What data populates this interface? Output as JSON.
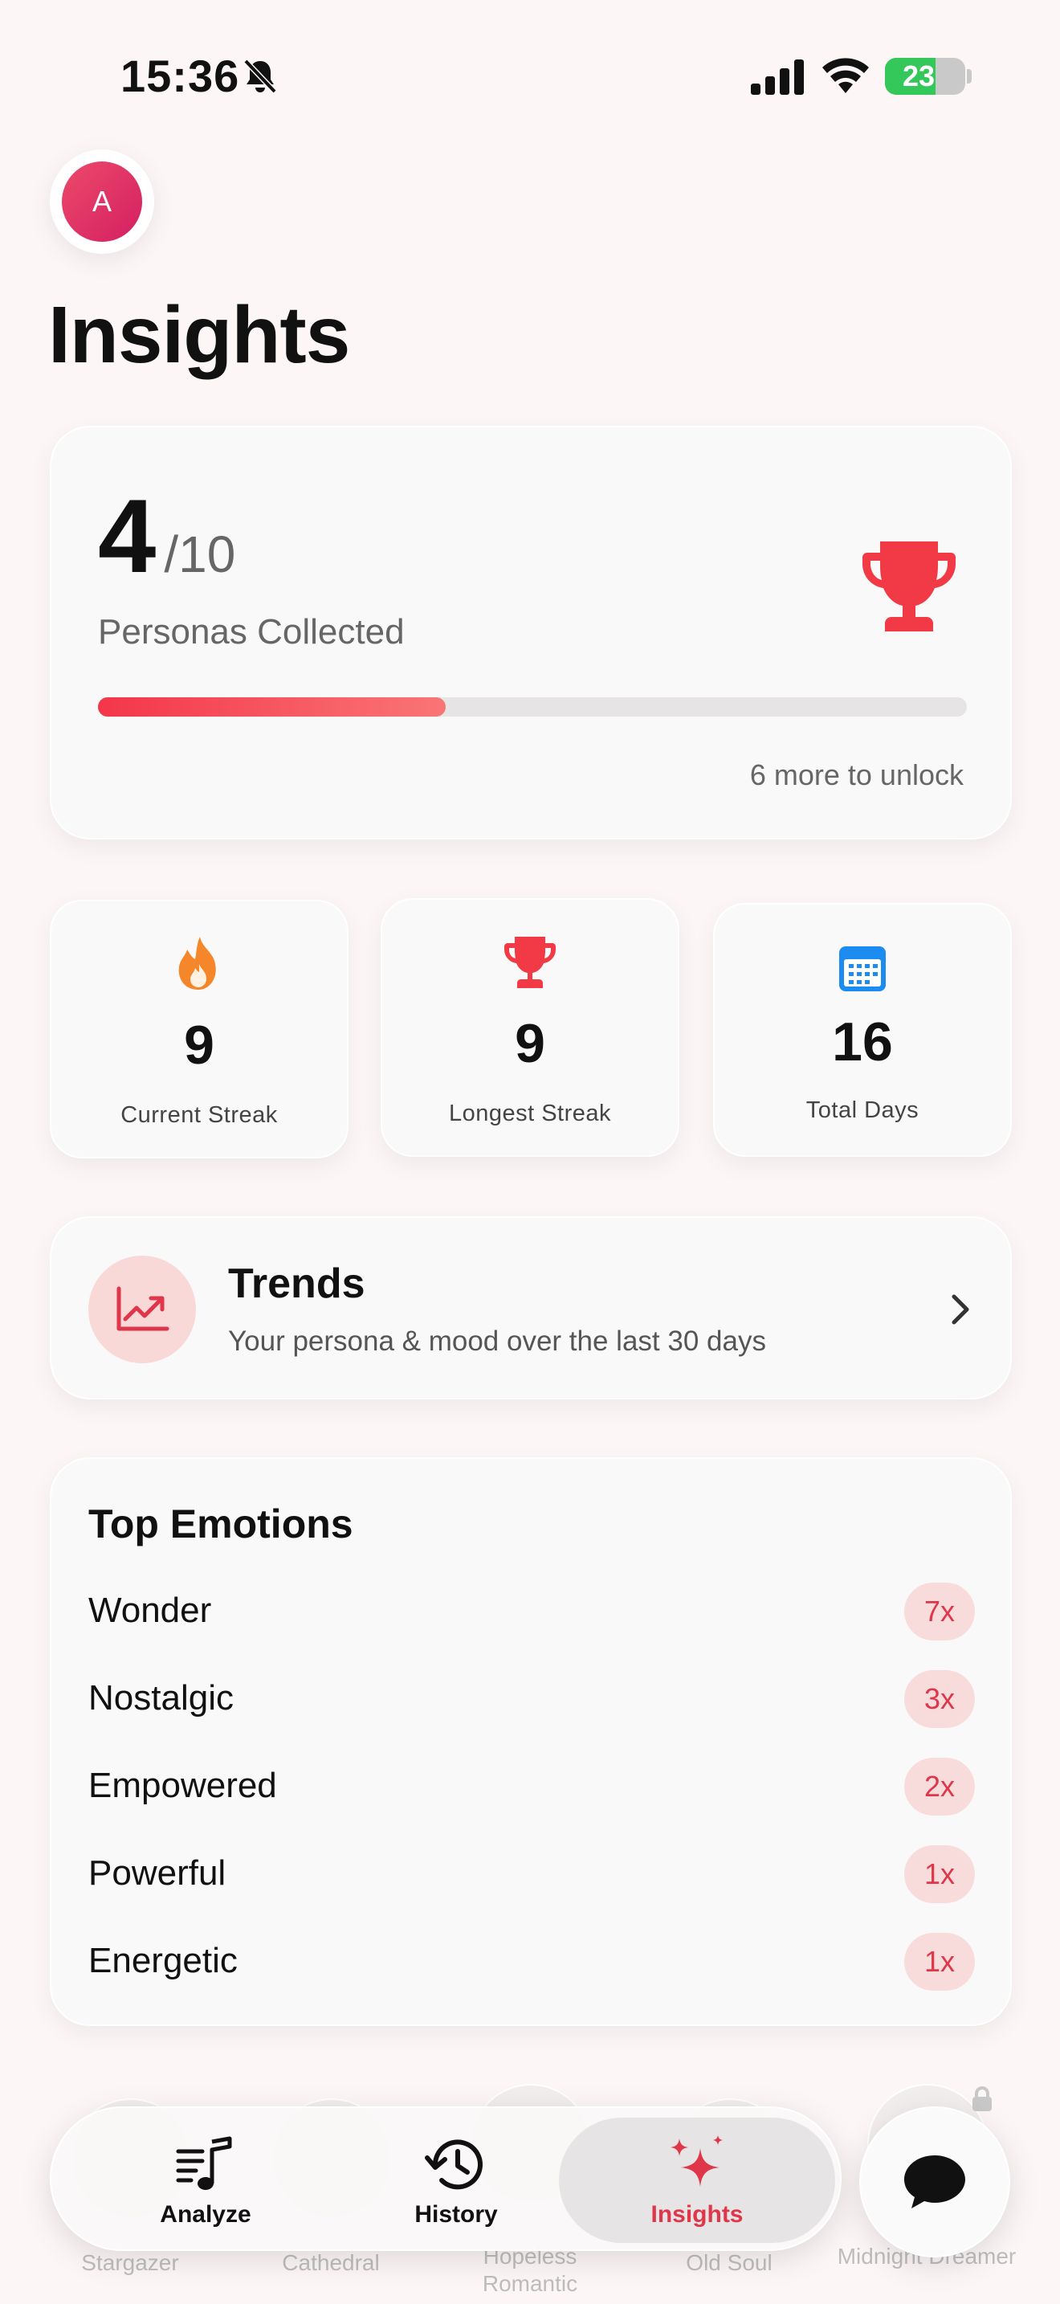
{
  "status_bar": {
    "time": "15:36",
    "battery_level": "23",
    "battery_percent": 0.23,
    "icons": [
      "bell-slash-icon",
      "signal-icon",
      "wifi-icon",
      "battery-charging-icon"
    ]
  },
  "avatar": {
    "initial": "A",
    "color_from": "#ec4a6a",
    "color_to": "#d41f62"
  },
  "page_title": "Insights",
  "personas": {
    "collected": "4",
    "total": "/10",
    "label": "Personas Collected",
    "progress": 0.4,
    "unlock_text": "6 more to unlock",
    "icon": "trophy-icon",
    "accent": "#f4364a"
  },
  "stats": [
    {
      "icon": "flame-icon",
      "value": "9",
      "label": "Current Streak",
      "color": "#f5862a"
    },
    {
      "icon": "trophy-icon",
      "value": "9",
      "label": "Longest Streak",
      "color": "#f13a45"
    },
    {
      "icon": "calendar-icon",
      "value": "16",
      "label": "Total Days",
      "color": "#1d8cf0"
    }
  ],
  "trends": {
    "title": "Trends",
    "subtitle": "Your persona & mood over the last 30 days",
    "icon": "chart-trend-up-icon"
  },
  "top_emotions": {
    "title": "Top Emotions",
    "items": [
      {
        "label": "Wonder",
        "count": "7x"
      },
      {
        "label": "Nostalgic",
        "count": "3x"
      },
      {
        "label": "Empowered",
        "count": "2x"
      },
      {
        "label": "Powerful",
        "count": "1x"
      },
      {
        "label": "Energetic",
        "count": "1x"
      }
    ]
  },
  "persona_shelf": {
    "items": [
      "Stargazer",
      "Cathedral",
      "Hopeless Romantic",
      "Old Soul",
      "Midnight Dreamer"
    ]
  },
  "tab_bar": {
    "tabs": [
      {
        "label": "Analyze",
        "icon": "music-list-icon"
      },
      {
        "label": "History",
        "icon": "clock-history-icon"
      },
      {
        "label": "Insights",
        "icon": "sparkles-icon",
        "active": true
      }
    ],
    "chat_icon": "chat-bubble-icon"
  }
}
